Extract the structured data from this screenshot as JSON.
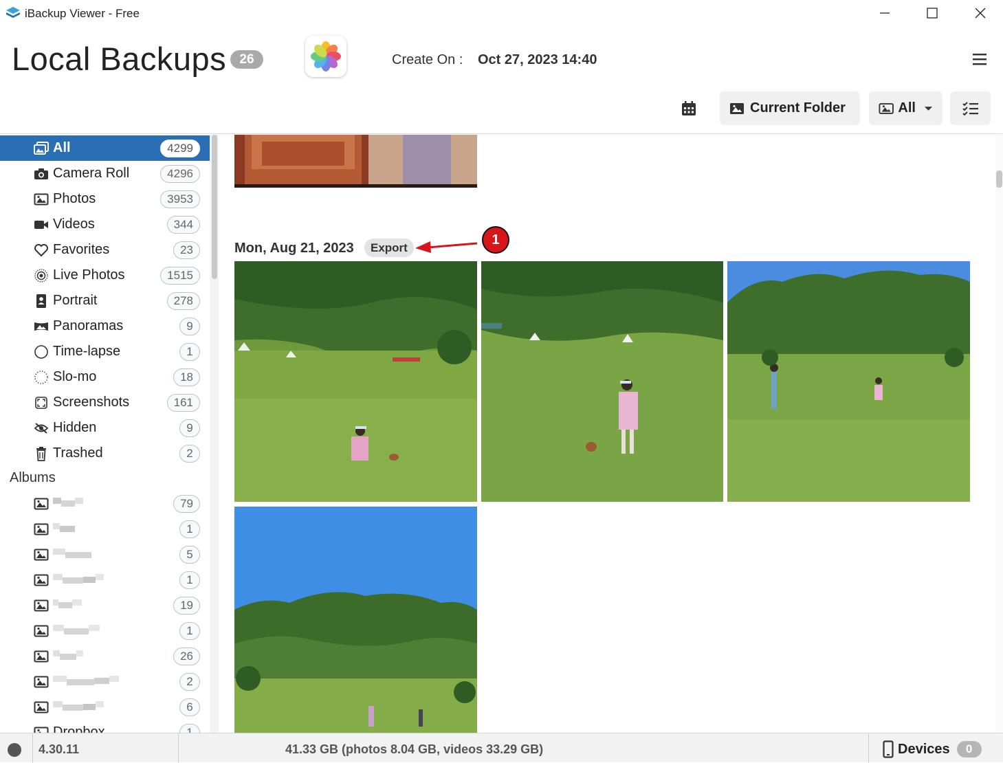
{
  "window": {
    "title": "iBackup Viewer - Free",
    "logo_icon": "stack-icon"
  },
  "header": {
    "title": "Local Backups",
    "backup_count": "26",
    "create_label": "Create On :",
    "create_value": "Oct 27, 2023 14:40",
    "app_icon": "photos-flower-icon"
  },
  "toolbar": {
    "calendar_icon": "calendar-icon",
    "current_folder_label": "Current Folder",
    "filter_label": "All",
    "select_icon": "checklist-icon"
  },
  "sidebar": {
    "items": [
      {
        "label": "All",
        "count": "4299",
        "icon": "all-photos-icon",
        "active": true
      },
      {
        "label": "Camera Roll",
        "count": "4296",
        "icon": "camera-icon"
      },
      {
        "label": "Photos",
        "count": "3953",
        "icon": "image-icon"
      },
      {
        "label": "Videos",
        "count": "344",
        "icon": "video-icon"
      },
      {
        "label": "Favorites",
        "count": "23",
        "icon": "heart-icon"
      },
      {
        "label": "Live Photos",
        "count": "1515",
        "icon": "live-photo-icon"
      },
      {
        "label": "Portrait",
        "count": "278",
        "icon": "portrait-icon"
      },
      {
        "label": "Panoramas",
        "count": "9",
        "icon": "panorama-icon"
      },
      {
        "label": "Time-lapse",
        "count": "1",
        "icon": "timelapse-icon"
      },
      {
        "label": "Slo-mo",
        "count": "18",
        "icon": "slomo-icon"
      },
      {
        "label": "Screenshots",
        "count": "161",
        "icon": "screenshot-icon"
      },
      {
        "label": "Hidden",
        "count": "9",
        "icon": "hidden-eye-icon"
      },
      {
        "label": "Trashed",
        "count": "2",
        "icon": "trash-icon"
      }
    ],
    "albums_heading": "Albums",
    "albums": [
      {
        "count": "79"
      },
      {
        "count": "1"
      },
      {
        "count": "5"
      },
      {
        "count": "1"
      },
      {
        "count": "19"
      },
      {
        "count": "1"
      },
      {
        "count": "26"
      },
      {
        "count": "2"
      },
      {
        "count": "6"
      },
      {
        "label": "Dropbox",
        "count": "1"
      }
    ]
  },
  "content": {
    "date_heading": "Mon, Aug 21, 2023",
    "export_label": "Export",
    "callout_number": "1"
  },
  "statusbar": {
    "version": "4.30.11",
    "storage": "41.33 GB (photos 8.04 GB, videos 33.29 GB)",
    "devices_label": "Devices",
    "devices_count": "0"
  },
  "colors": {
    "accent": "#2a6fb6",
    "callout": "#d7161b",
    "badge_gray": "#a9a9a9"
  }
}
